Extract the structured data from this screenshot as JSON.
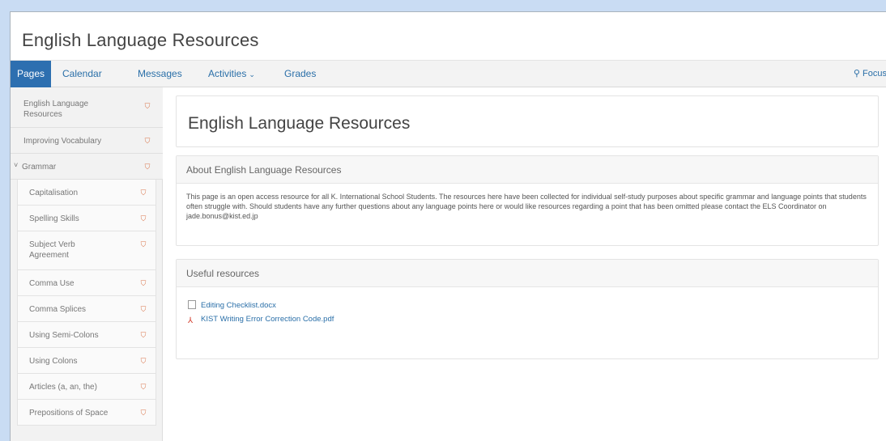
{
  "site": {
    "title": "English Language Resources"
  },
  "nav": {
    "items": [
      {
        "label": "Pages"
      },
      {
        "label": "Calendar"
      },
      {
        "label": "Messages"
      },
      {
        "label": "Activities"
      },
      {
        "label": "Grades"
      }
    ],
    "activities_caret": "⌄",
    "focus_label": "Focus",
    "focus_icon": "search-icon"
  },
  "sidebar": {
    "items": [
      {
        "label": "English Language Resources"
      },
      {
        "label": "Improving Vocabulary"
      },
      {
        "label": "Grammar",
        "expander": "˅"
      },
      {
        "label": "Capitalisation"
      },
      {
        "label": "Spelling Skills"
      },
      {
        "label": "Subject Verb Agreement"
      },
      {
        "label": "Comma Use"
      },
      {
        "label": "Comma Splices"
      },
      {
        "label": "Using Semi-Colons"
      },
      {
        "label": "Using Colons"
      },
      {
        "label": "Articles (a, an, the)"
      },
      {
        "label": "Prepositions of Space"
      }
    ],
    "lock_icon": "lock-icon",
    "lock_color": "#d9744a"
  },
  "main": {
    "heading": "English Language Resources",
    "about": {
      "title": "About English Language Resources",
      "body": "This page is an open access resource for all K. International School Students. The resources here have been collected for individual self-study purposes about specific grammar and language points that students often struggle with. Should students have any further questions about any language points here or would like resources regarding a point that has been omitted please contact the ELS Coordinator on jade.bonus@kist.ed.jp"
    },
    "useful": {
      "title": "Useful resources",
      "links": [
        {
          "label": "Editing Checklist.docx",
          "icon": "document-icon"
        },
        {
          "label": "KIST Writing Error Correction Code.pdf",
          "icon": "pdf-icon"
        }
      ]
    }
  },
  "colors": {
    "accent": "#2d6fb0",
    "link": "#2a6fa8",
    "background": "#c9dcf3"
  }
}
